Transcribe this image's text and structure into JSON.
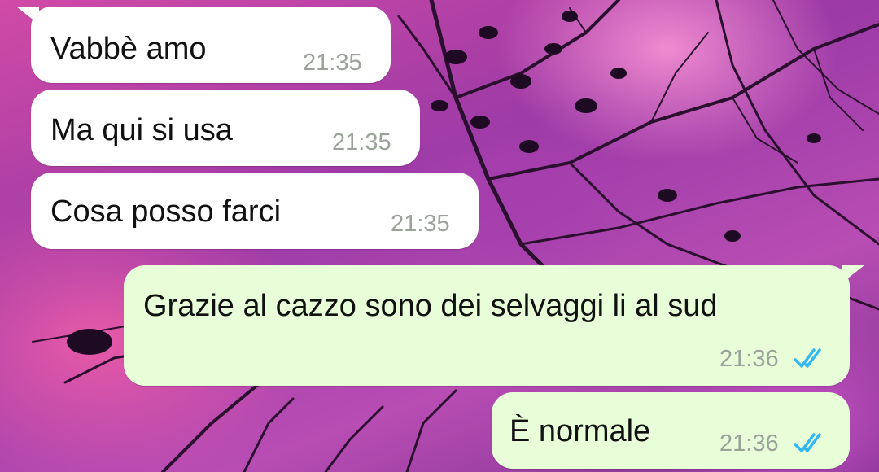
{
  "conversation": {
    "messages": [
      {
        "direction": "incoming",
        "text": "Vabbè amo",
        "time": "21:35"
      },
      {
        "direction": "incoming",
        "text": "Ma qui si usa",
        "time": "21:35"
      },
      {
        "direction": "incoming",
        "text": "Cosa posso farci",
        "time": "21:35"
      },
      {
        "direction": "outgoing",
        "text": "Grazie al cazzo sono dei selvaggi li al sud",
        "time": "21:36",
        "status": "read",
        "status_icon": "double-check-icon"
      },
      {
        "direction": "outgoing",
        "text": "È normale",
        "time": "21:36",
        "status": "read",
        "status_icon": "double-check-icon"
      }
    ]
  },
  "colors": {
    "incoming_bubble": "#ffffff",
    "outgoing_bubble": "#e7fed8",
    "read_tick": "#34b7f1",
    "timestamp": "#9aa29a"
  }
}
